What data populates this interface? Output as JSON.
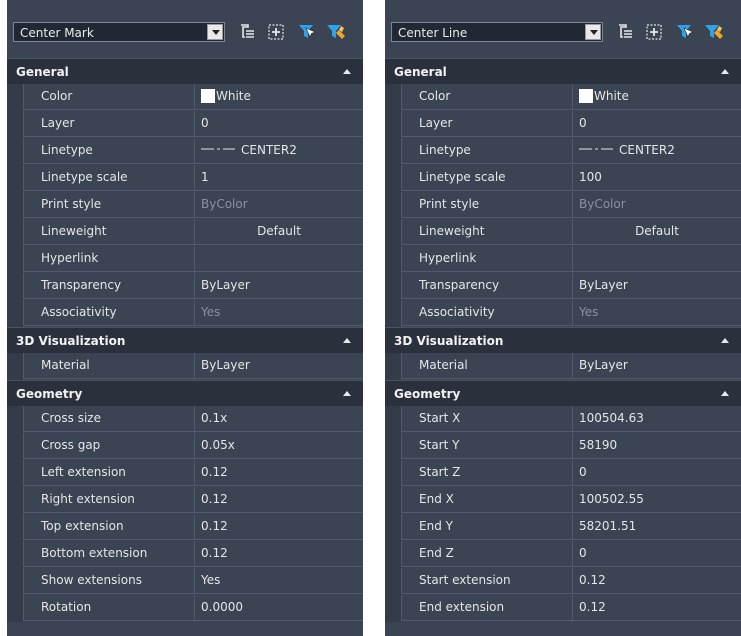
{
  "panels": [
    {
      "selector": "Center Mark",
      "sections": [
        {
          "title": "General",
          "rows": [
            {
              "name": "Color",
              "value": "White",
              "kind": "color"
            },
            {
              "name": "Layer",
              "value": "0"
            },
            {
              "name": "Linetype",
              "value": "CENTER2",
              "kind": "linetype"
            },
            {
              "name": "Linetype scale",
              "value": "1"
            },
            {
              "name": "Print style",
              "value": "ByColor",
              "muted": true
            },
            {
              "name": "Lineweight",
              "value": "Default",
              "centered": true
            },
            {
              "name": "Hyperlink",
              "value": ""
            },
            {
              "name": "Transparency",
              "value": "ByLayer"
            },
            {
              "name": "Associativity",
              "value": "Yes",
              "muted": true
            }
          ]
        },
        {
          "title": "3D Visualization",
          "rows": [
            {
              "name": "Material",
              "value": "ByLayer"
            }
          ]
        },
        {
          "title": "Geometry",
          "rows": [
            {
              "name": "Cross size",
              "value": "0.1x"
            },
            {
              "name": "Cross gap",
              "value": "0.05x"
            },
            {
              "name": "Left extension",
              "value": "0.12"
            },
            {
              "name": "Right extension",
              "value": "0.12"
            },
            {
              "name": "Top extension",
              "value": "0.12"
            },
            {
              "name": "Bottom extension",
              "value": "0.12"
            },
            {
              "name": "Show extensions",
              "value": "Yes"
            },
            {
              "name": "Rotation",
              "value": "0.0000"
            }
          ]
        }
      ]
    },
    {
      "selector": "Center Line",
      "sections": [
        {
          "title": "General",
          "rows": [
            {
              "name": "Color",
              "value": "White",
              "kind": "color"
            },
            {
              "name": "Layer",
              "value": "0"
            },
            {
              "name": "Linetype",
              "value": "CENTER2",
              "kind": "linetype"
            },
            {
              "name": "Linetype scale",
              "value": "100"
            },
            {
              "name": "Print style",
              "value": "ByColor",
              "muted": true
            },
            {
              "name": "Lineweight",
              "value": "Default",
              "centered": true
            },
            {
              "name": "Hyperlink",
              "value": ""
            },
            {
              "name": "Transparency",
              "value": "ByLayer"
            },
            {
              "name": "Associativity",
              "value": "Yes",
              "muted": true
            }
          ]
        },
        {
          "title": "3D Visualization",
          "rows": [
            {
              "name": "Material",
              "value": "ByLayer"
            }
          ]
        },
        {
          "title": "Geometry",
          "rows": [
            {
              "name": "Start X",
              "value": "100504.63"
            },
            {
              "name": "Start Y",
              "value": "58190"
            },
            {
              "name": "Start Z",
              "value": "0"
            },
            {
              "name": "End X",
              "value": "100502.55"
            },
            {
              "name": "End Y",
              "value": "58201.51"
            },
            {
              "name": "End Z",
              "value": "0"
            },
            {
              "name": "Start extension",
              "value": "0.12"
            },
            {
              "name": "End extension",
              "value": "0.12"
            }
          ]
        }
      ]
    }
  ],
  "toolbar_icons": [
    "toggle-pickadd-icon",
    "select-objects-icon",
    "quick-select-icon",
    "select-similar-icon"
  ],
  "colors": {
    "panel_bg": "#3b4453",
    "section_bg": "#2b313c",
    "grid_line": "#525b6b",
    "text": "#e6e6e6",
    "muted_text": "#8a919d",
    "icon_blue": "#2fa3e6",
    "icon_orange": "#f0a62a"
  }
}
